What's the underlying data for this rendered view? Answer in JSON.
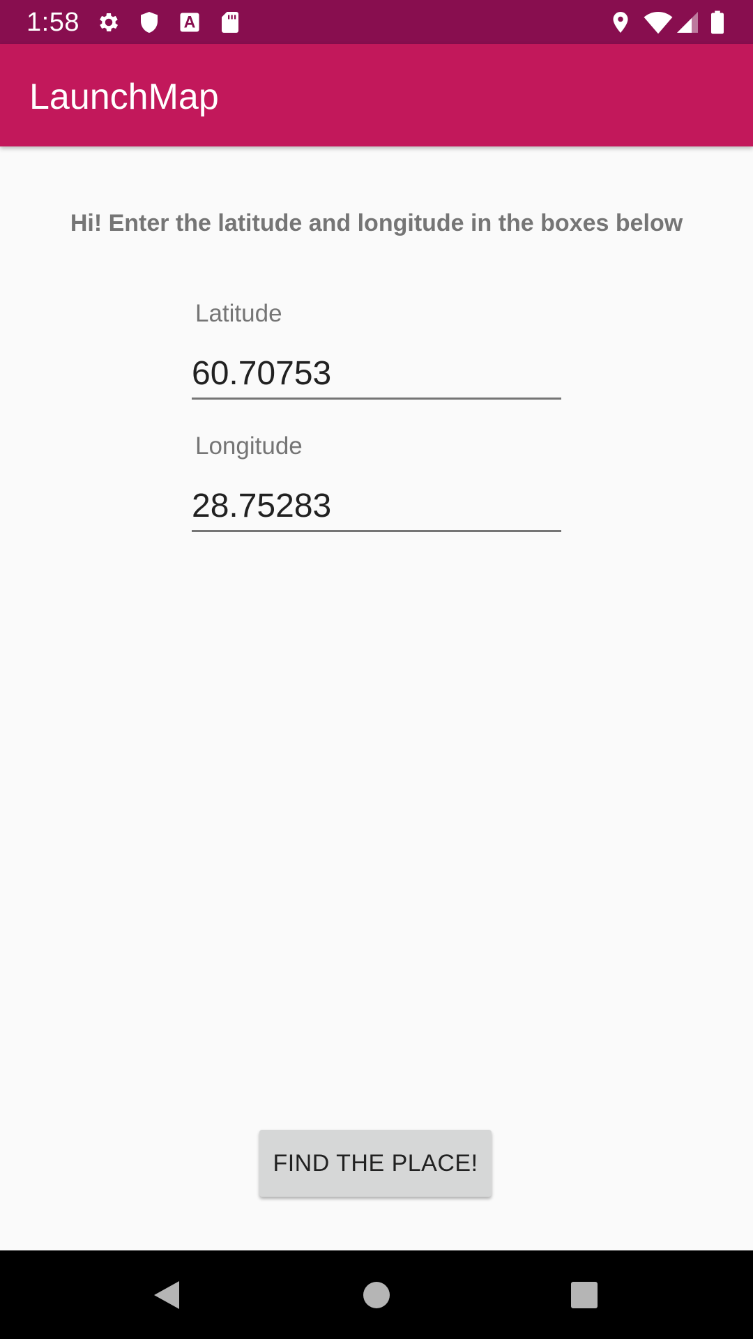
{
  "status_bar": {
    "time": "1:58",
    "left_icons": [
      "gear-icon",
      "shield-icon",
      "font-icon",
      "sd-card-icon"
    ],
    "right_icons": [
      "location-icon",
      "wifi-icon",
      "signal-icon",
      "battery-icon"
    ]
  },
  "app_bar": {
    "title": "LaunchMap"
  },
  "main": {
    "instruction": "Hi! Enter the latitude and longitude in the boxes below",
    "latitude": {
      "label": "Latitude",
      "value": "60.70753"
    },
    "longitude": {
      "label": "Longitude",
      "value": "28.75283"
    },
    "find_button_label": "FIND THE PLACE!"
  },
  "nav_bar": {
    "buttons": [
      "back-icon",
      "home-icon",
      "recents-icon"
    ]
  },
  "colors": {
    "status_bar": "#880e4f",
    "app_bar": "#c2185b",
    "background": "#fafafa",
    "button": "#d6d7d7"
  }
}
